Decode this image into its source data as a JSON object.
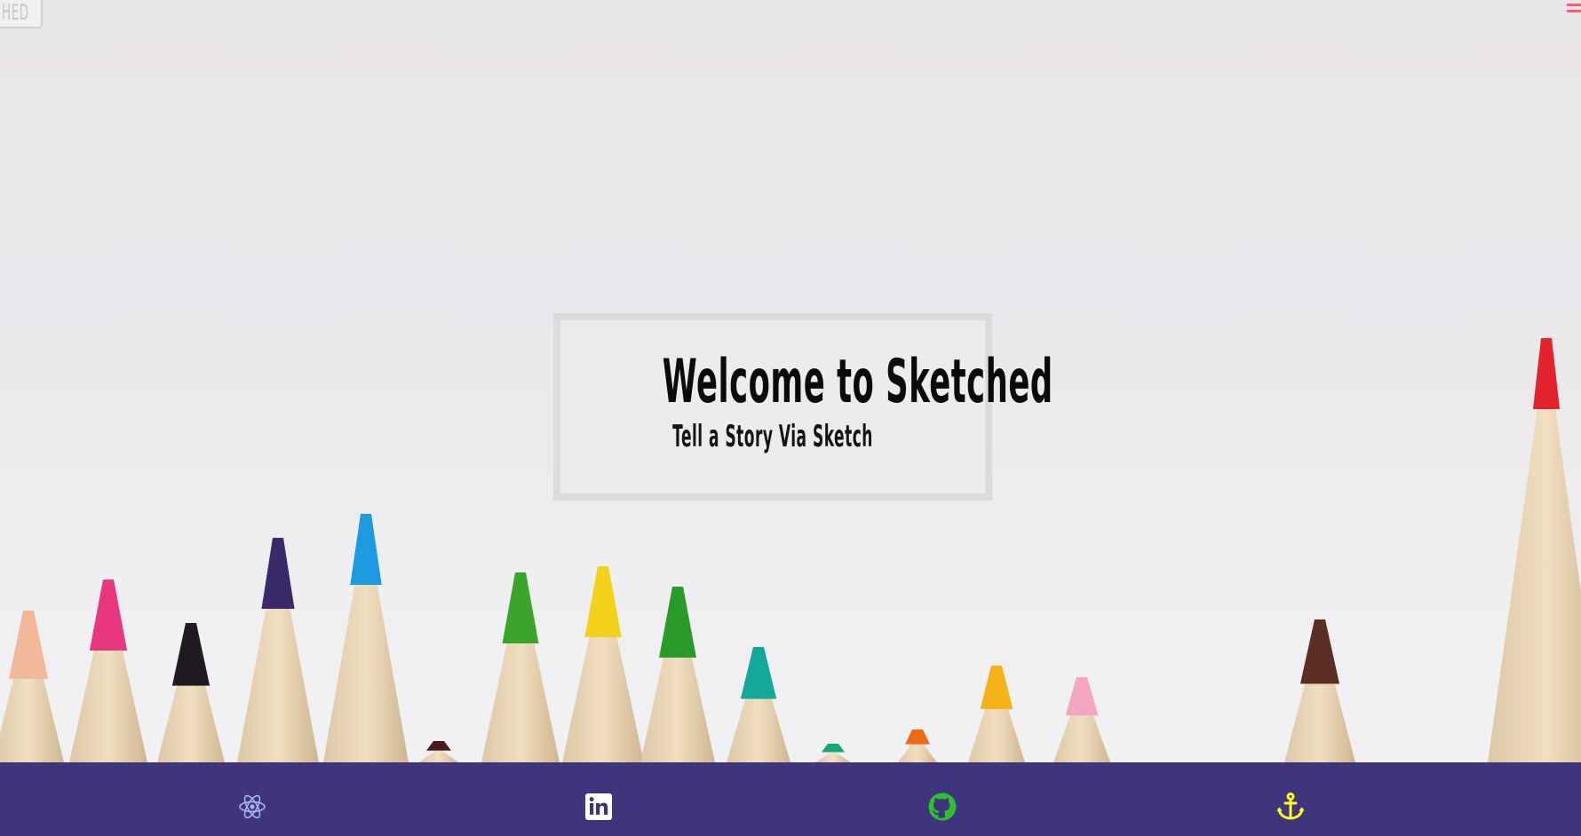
{
  "header": {
    "logo_text": "HED",
    "menu_icon": "hamburger-menu-icon",
    "menu_color": "#ff5a78"
  },
  "hero": {
    "title": "Welcome to Sketched",
    "subtitle": "Tell a Story Via Sketch",
    "background_image": "colored-pencils-photo"
  },
  "footer": {
    "background_color": "#3e357c",
    "links": [
      {
        "icon": "react-icon",
        "color": "#a9b4ec"
      },
      {
        "icon": "linkedin-icon",
        "color": "#ffffff"
      },
      {
        "icon": "github-icon",
        "color": "#2fbf2f"
      },
      {
        "icon": "anchor-icon",
        "color": "#ffff1a"
      }
    ]
  }
}
